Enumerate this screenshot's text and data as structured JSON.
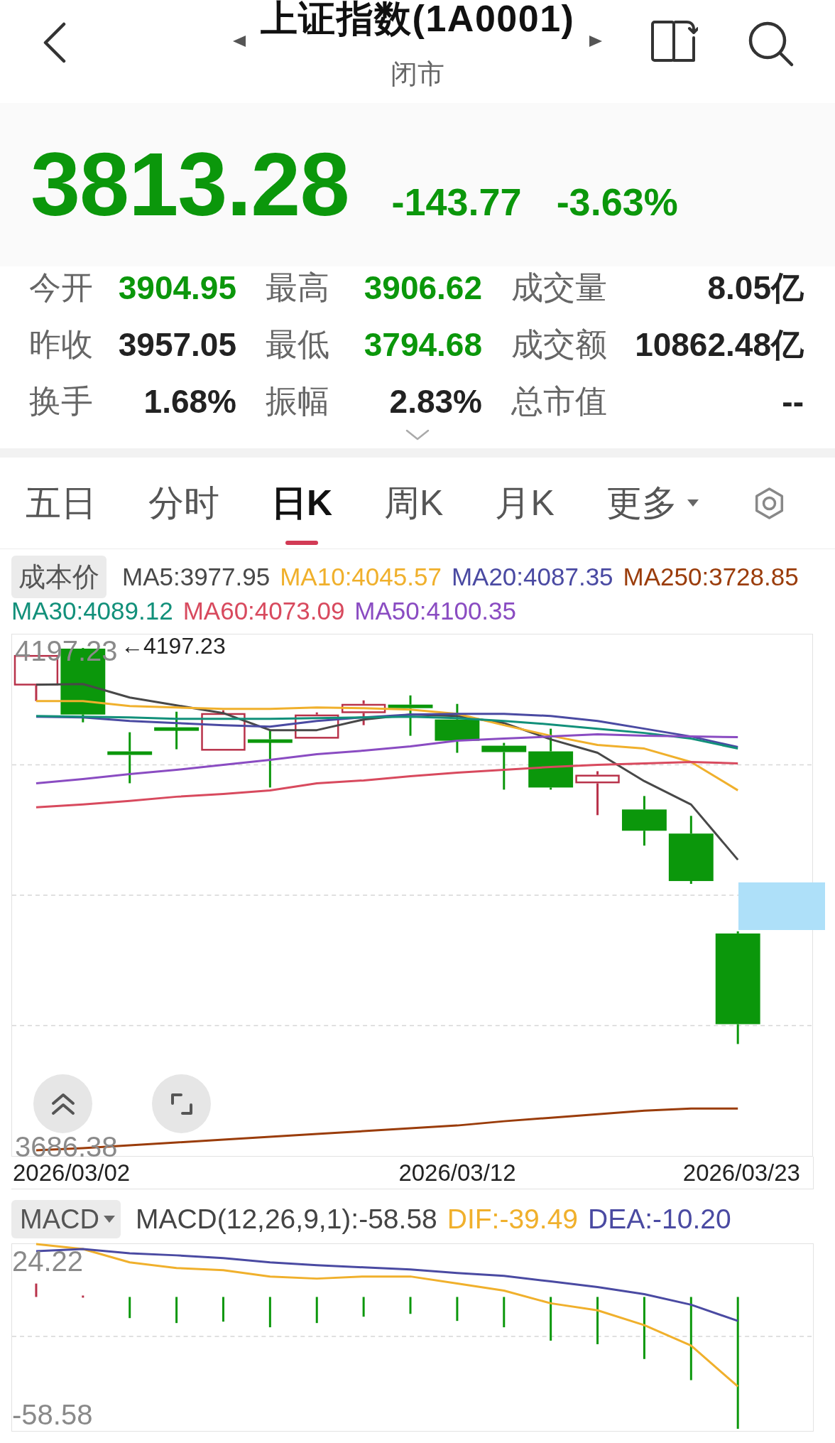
{
  "header": {
    "title": "上证指数(1A0001)",
    "status": "闭市"
  },
  "quote": {
    "price": "3813.28",
    "change": "-143.77",
    "change_percent": "-3.63%",
    "falling": true
  },
  "stats": [
    {
      "label": "今开",
      "value": "3904.95",
      "falling": true
    },
    {
      "label": "最高",
      "value": "3906.62",
      "falling": true
    },
    {
      "label": "成交量",
      "value": "8.05亿",
      "falling": false
    },
    {
      "label": "昨收",
      "value": "3957.05",
      "falling": false
    },
    {
      "label": "最低",
      "value": "3794.68",
      "falling": true
    },
    {
      "label": "成交额",
      "value": "10862.48亿",
      "falling": false
    },
    {
      "label": "换手",
      "value": "1.68%",
      "falling": false
    },
    {
      "label": "振幅",
      "value": "2.83%",
      "falling": false
    },
    {
      "label": "总市值",
      "value": "--",
      "falling": false
    }
  ],
  "tabs": [
    {
      "label": "五日",
      "kind": "tab",
      "selected": false
    },
    {
      "label": "分时",
      "kind": "tab",
      "selected": false
    },
    {
      "label": "日K",
      "kind": "tab",
      "selected": true
    },
    {
      "label": "周K",
      "kind": "tab",
      "selected": false
    },
    {
      "label": "月K",
      "kind": "tab",
      "selected": false
    },
    {
      "label": "更多",
      "kind": "menu",
      "selected": false
    }
  ],
  "kline": {
    "cost_button": "成本价",
    "indicators": [
      {
        "label": "MA5:3977.95",
        "color": "#484848"
      },
      {
        "label": "MA10:4045.57",
        "color": "#f0b02c"
      },
      {
        "label": "MA20:4087.35",
        "color": "#4a4aa2"
      },
      {
        "label": "MA250:3728.85",
        "color": "#9a3c0a"
      },
      {
        "label": "MA30:4089.12",
        "color": "#12907a"
      },
      {
        "label": "MA60:4073.09",
        "color": "#d84a5e"
      },
      {
        "label": "MA50:4100.35",
        "color": "#8a4cc2"
      }
    ],
    "axis_max": "4197.23",
    "max_marker": "←4197.23",
    "axis_min": "3686.38",
    "dates": [
      "2026/03/02",
      "2026/03/12",
      "2026/03/23"
    ]
  },
  "macd": {
    "selector": "MACD",
    "indicators": [
      {
        "label": "MACD(12,26,9,1):-58.58",
        "color": "#444444"
      },
      {
        "label": "DIF:-39.49",
        "color": "#f0b02c"
      },
      {
        "label": "DEA:-10.20",
        "color": "#4a4aa2"
      }
    ],
    "axis_max": "24.22",
    "axis_min": "-58.58"
  }
}
